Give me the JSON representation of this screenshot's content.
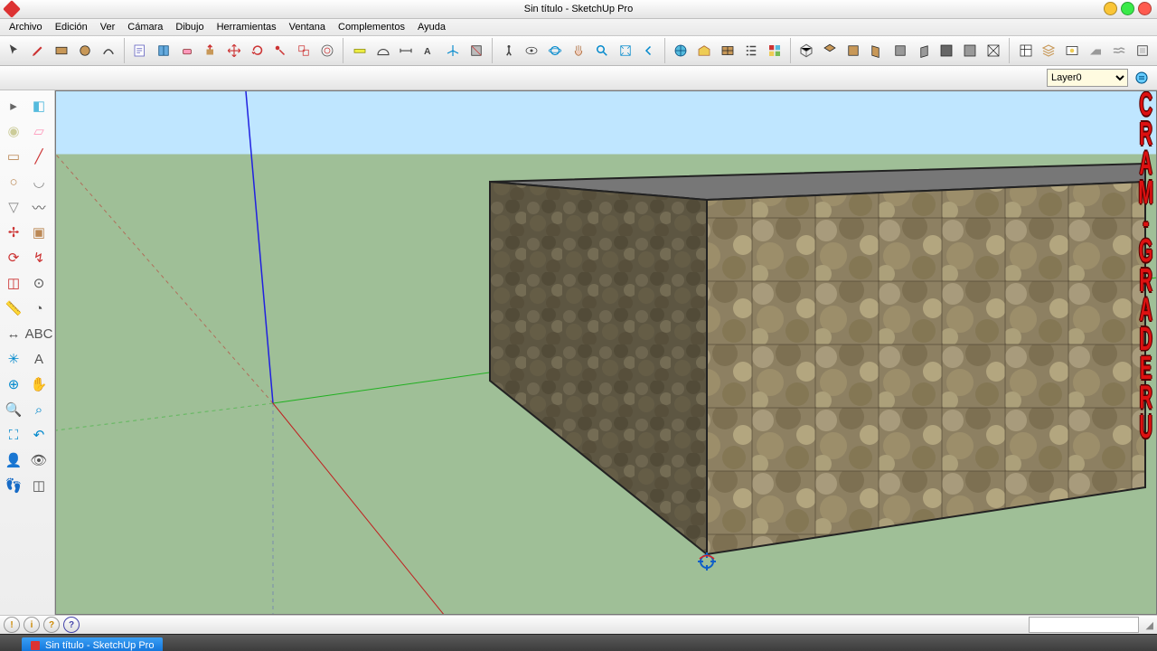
{
  "title": "Sin título - SketchUp Pro",
  "menu": [
    "Archivo",
    "Edición",
    "Ver",
    "Cámara",
    "Dibujo",
    "Herramientas",
    "Ventana",
    "Complementos",
    "Ayuda"
  ],
  "layer_selected": "Layer0",
  "task_label": "Sin título - SketchUp Pro",
  "watermark": "CRAM-GRADERU",
  "top_tools": [
    "select",
    "pencil",
    "rectangle",
    "circle",
    "arc",
    "note",
    "book",
    "eraser",
    "pushpull",
    "move",
    "rotate",
    "followme",
    "scale",
    "offset",
    "tape",
    "protractor",
    "dimension",
    "text",
    "axes",
    "section",
    "walk",
    "lookaround",
    "orbit",
    "pan",
    "zoom",
    "zoom-extents",
    "previous",
    "geoloc",
    "warehouse",
    "component",
    "outliner",
    "materials",
    "iso",
    "top",
    "front",
    "right",
    "back",
    "left",
    "shade",
    "shade2",
    "wireframe",
    "styles",
    "layers",
    "scenes",
    "shadows",
    "fog",
    "prefs"
  ],
  "side_tools": [
    [
      "select",
      "#666",
      "▸"
    ],
    [
      "components",
      "#5bd",
      "◧"
    ],
    [
      "paint",
      "#cc9",
      "◉"
    ],
    [
      "eraser",
      "#f9b",
      "▱"
    ],
    [
      "rect",
      "#b85",
      "▭"
    ],
    [
      "line",
      "#c33",
      "╱"
    ],
    [
      "circle",
      "#b85",
      "○"
    ],
    [
      "arc",
      "#888",
      "◡"
    ],
    [
      "poly",
      "#888",
      "▽"
    ],
    [
      "freehand",
      "#555",
      "〰"
    ],
    [
      "move",
      "#c33",
      "✢"
    ],
    [
      "pushpull",
      "#b85",
      "▣"
    ],
    [
      "rotate",
      "#c33",
      "⟳"
    ],
    [
      "followme",
      "#c33",
      "↯"
    ],
    [
      "scale",
      "#c33",
      "◫"
    ],
    [
      "offset",
      "#555",
      "⊙"
    ],
    [
      "tape",
      "#cc0",
      "📏"
    ],
    [
      "protractor",
      "#555",
      "◔"
    ],
    [
      "dim",
      "#555",
      "↔"
    ],
    [
      "text",
      "#555",
      "ABC"
    ],
    [
      "axes",
      "#08c",
      "✳"
    ],
    [
      "3dtext",
      "#555",
      "A"
    ],
    [
      "orbit",
      "#08c",
      "⊕"
    ],
    [
      "pan",
      "#ca8",
      "✋"
    ],
    [
      "zoom",
      "#08c",
      "🔍"
    ],
    [
      "zoomw",
      "#08c",
      "⌕"
    ],
    [
      "zoomext",
      "#08c",
      "⛶"
    ],
    [
      "prev",
      "#08c",
      "↶"
    ],
    [
      "pos",
      "#555",
      "👤"
    ],
    [
      "look",
      "#555",
      "👁"
    ],
    [
      "walk",
      "#555",
      "👣"
    ],
    [
      "section",
      "#555",
      "◫"
    ]
  ]
}
